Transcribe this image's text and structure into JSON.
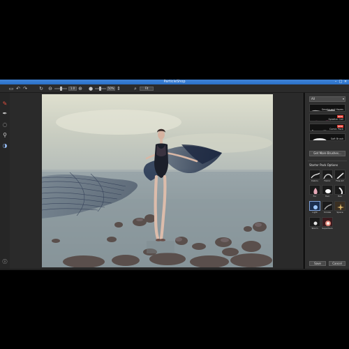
{
  "window": {
    "title": "ParticleShop"
  },
  "toolbar": {
    "zoom_value": "1.0",
    "size_value": "50%",
    "view_label": "Fit"
  },
  "left_tools": [
    {
      "icon": "brush-icon"
    },
    {
      "icon": "pen-icon"
    },
    {
      "icon": "lasso-icon"
    },
    {
      "icon": "eyedropper-icon"
    },
    {
      "icon": "color-wheel-icon"
    }
  ],
  "right_panel": {
    "brush_set_label": "All",
    "brushes": [
      {
        "name": "Smoke and Hazes",
        "badge": ""
      },
      {
        "name": "Splatter Cell",
        "badge": "NEW"
      },
      {
        "name": "Comic Pack",
        "badge": "NEW"
      },
      {
        "name": "Soft Brush",
        "badge": ""
      }
    ],
    "get_brushes_label": "Get More Brushes...",
    "pack_options_heading": "Starter Pack Options",
    "pack_items": [
      {
        "label": "Debris"
      },
      {
        "label": "Fabric"
      },
      {
        "label": "Fine Art"
      },
      {
        "label": "Fur"
      },
      {
        "label": "Hair"
      },
      {
        "label": "Hair"
      },
      {
        "label": "Light"
      },
      {
        "label": "Smoke"
      },
      {
        "label": "Space"
      },
      {
        "label": "Storm"
      },
      {
        "label": "Superhero"
      }
    ],
    "save_label": "Save",
    "cancel_label": "Cancel"
  },
  "colors": {
    "title_bar": "#2a6fc6",
    "ui_dark": "#2b2b2b",
    "new_badge": "#e0382f"
  }
}
